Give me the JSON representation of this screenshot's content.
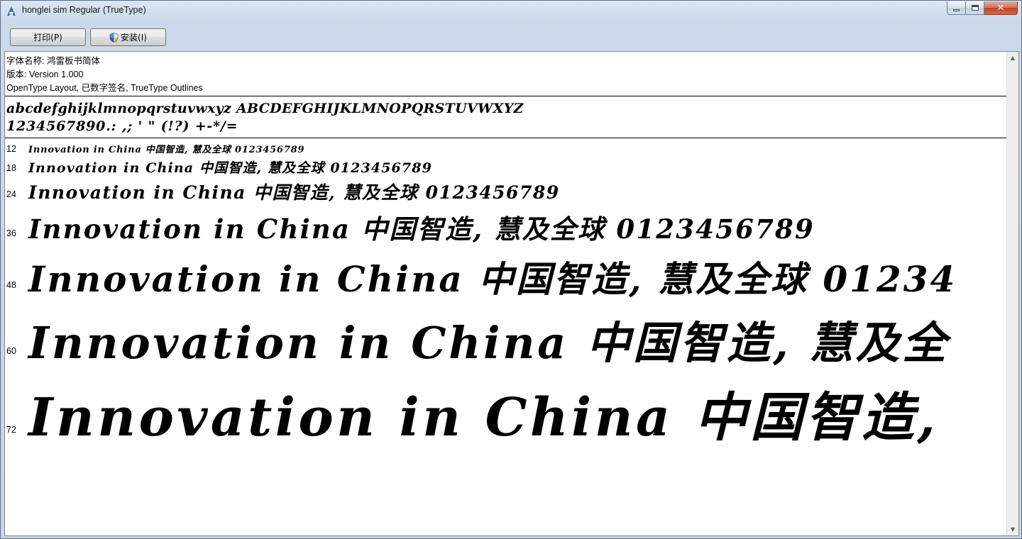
{
  "window": {
    "title": "honglei sim Regular (TrueType)"
  },
  "caption": {
    "close_symbol": "✕"
  },
  "toolbar": {
    "print_label": "打印(P)",
    "install_label": "安装(I)"
  },
  "meta": {
    "font_name": "字体名称: 鸿雷板书简体",
    "version": "版本: Version 1.000",
    "features": "OpenType Layout, 已数字签名, TrueType Outlines"
  },
  "charset": {
    "letters": "abcdefghijklmnopqrstuvwxyz ABCDEFGHIJKLMNOPQRSTUVWXYZ",
    "symbols": "1234567890.: ,; ' \" (!?) +-*/="
  },
  "samples": [
    {
      "size": "12",
      "text": "Innovation in China 中国智造, 慧及全球 0123456789"
    },
    {
      "size": "18",
      "text": "Innovation in China 中国智造, 慧及全球 0123456789"
    },
    {
      "size": "24",
      "text": "Innovation in China 中国智造, 慧及全球 0123456789"
    },
    {
      "size": "36",
      "text": "Innovation in China 中国智造, 慧及全球 0123456789"
    },
    {
      "size": "48",
      "text": "Innovation in China 中国智造, 慧及全球 01234"
    },
    {
      "size": "60",
      "text": "Innovation in China 中国智造, 慧及全"
    },
    {
      "size": "72",
      "text": "Innovation in China 中国智造, "
    }
  ],
  "scrollbar": {
    "up_arrow": "▲",
    "down_arrow": "▼"
  }
}
